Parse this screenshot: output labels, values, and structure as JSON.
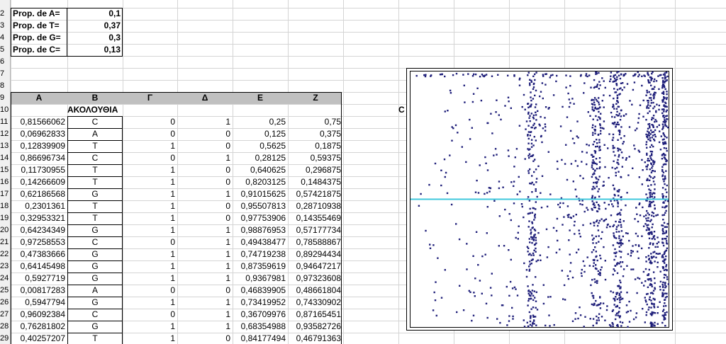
{
  "row_numbers": [
    "2",
    "3",
    "4",
    "5",
    "6",
    "7",
    "8",
    "9",
    "10",
    "11",
    "12",
    "13",
    "14",
    "15",
    "16",
    "17",
    "18",
    "19",
    "20",
    "21",
    "22",
    "23",
    "24",
    "25",
    "26",
    "27",
    "28",
    "29"
  ],
  "proportions": [
    {
      "label": "Prop. de A=",
      "value": "0,1"
    },
    {
      "label": "Prop. de T=",
      "value": "0,37"
    },
    {
      "label": "Prop. de G=",
      "value": "0,3"
    },
    {
      "label": "Prop. de C=",
      "value": "0,13"
    }
  ],
  "column_headers": [
    "A",
    "B",
    "Γ",
    "Δ",
    "E",
    "Z"
  ],
  "sequence_header": "ΑΚΟΛΟΥΘΙΑ",
  "side_label": "C",
  "rows": [
    [
      "0,81566062",
      "C",
      "0",
      "1",
      "0,25",
      "0,75"
    ],
    [
      "0,06962833",
      "A",
      "0",
      "0",
      "0,125",
      "0,375"
    ],
    [
      "0,12839909",
      "T",
      "1",
      "0",
      "0,5625",
      "0,1875"
    ],
    [
      "0,86696734",
      "C",
      "0",
      "1",
      "0,28125",
      "0,59375"
    ],
    [
      "0,11730955",
      "T",
      "1",
      "0",
      "0,640625",
      "0,296875"
    ],
    [
      "0,14266609",
      "T",
      "1",
      "0",
      "0,8203125",
      "0,1484375"
    ],
    [
      "0,62186568",
      "G",
      "1",
      "1",
      "0,91015625",
      "0,57421875"
    ],
    [
      "0,2301361",
      "T",
      "1",
      "0",
      "0,95507813",
      "0,28710938"
    ],
    [
      "0,32953321",
      "T",
      "1",
      "0",
      "0,97753906",
      "0,14355469"
    ],
    [
      "0,64234349",
      "G",
      "1",
      "1",
      "0,98876953",
      "0,57177734"
    ],
    [
      "0,97258553",
      "C",
      "0",
      "1",
      "0,49438477",
      "0,78588867"
    ],
    [
      "0,47383666",
      "G",
      "1",
      "1",
      "0,74719238",
      "0,89294434"
    ],
    [
      "0,64145498",
      "G",
      "1",
      "1",
      "0,87359619",
      "0,94647217"
    ],
    [
      "0,5927719",
      "G",
      "1",
      "1",
      "0,9367981",
      "0,97323608"
    ],
    [
      "0,00817283",
      "A",
      "0",
      "0",
      "0,46839905",
      "0,48661804"
    ],
    [
      "0,5947794",
      "G",
      "1",
      "1",
      "0,73419952",
      "0,74330902"
    ],
    [
      "0,96092384",
      "C",
      "0",
      "1",
      "0,36709976",
      "0,87165451"
    ],
    [
      "0,76281802",
      "G",
      "1",
      "1",
      "0,68354988",
      "0,93582726"
    ],
    [
      "0,40257207",
      "T",
      "1",
      "0",
      "0,84177494",
      "0,46791363"
    ]
  ],
  "colors": {
    "grid": "#d4d4d4",
    "header_bg": "#c0c0c0",
    "points": "#1f1f7a",
    "line": "#3fc8dc"
  },
  "chart_data": {
    "type": "scatter",
    "series": [
      {
        "color": "#1f1f7a",
        "marker": "square"
      }
    ],
    "xlim": [
      0,
      1
    ],
    "ylim": [
      0,
      1
    ],
    "reference_line": {
      "y": 0.5,
      "color": "#3fc8dc"
    },
    "density_columns_x": [
      0.47,
      0.72,
      0.8,
      0.93
    ],
    "grid": false,
    "legend": "none"
  }
}
